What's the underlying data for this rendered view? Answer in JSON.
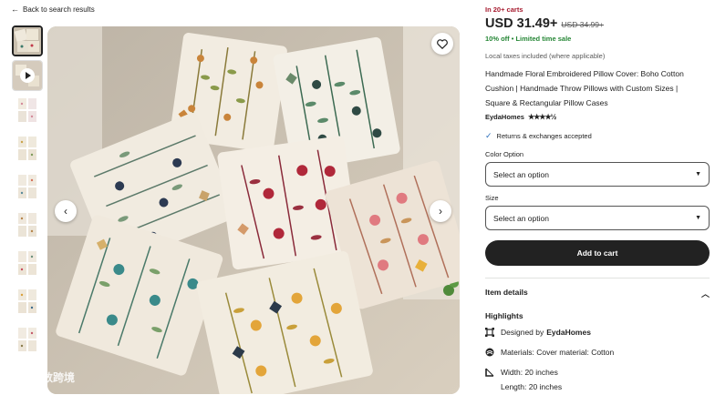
{
  "nav": {
    "back_label": "Back to search results"
  },
  "listing": {
    "carts_badge": "In 20+ carts",
    "price": "USD 31.49+",
    "original_price": "USD 34.99+",
    "discount_text": "10% off • Limited time sale",
    "tax_note": "Local taxes included (where applicable)",
    "title": "Handmade Floral Embroidered Pillow Cover: Boho Cotton Cushion | Handmade Throw Pillows with Custom Sizes | Square & Rectangular Pillow Cases",
    "shop_name": "EydaHomes",
    "rating_stars": "★★★★½",
    "returns_text": "Returns & exchanges accepted"
  },
  "options": {
    "color_label": "Color Option",
    "color_value": "Select an option",
    "size_label": "Size",
    "size_value": "Select an option"
  },
  "cart": {
    "add_label": "Add to cart"
  },
  "details": {
    "section_label": "Item details",
    "highlights_label": "Highlights",
    "designed_by_prefix": "Designed by",
    "designed_by_shop": "EydaHomes",
    "materials": "Materials: Cover material: Cotton",
    "width": "Width: 20 inches",
    "length": "Length: 20 inches"
  },
  "watermark": {
    "text": "大数跨境"
  },
  "icons": {
    "back": "arrow-left-icon",
    "favorite": "heart-icon",
    "prev": "chevron-left-icon",
    "next": "chevron-right-icon",
    "play": "play-icon",
    "check": "check-icon",
    "caret": "caret-down-icon",
    "collapse": "chevron-up-icon",
    "designed": "design-frame-icon",
    "materials": "materials-icon",
    "dimensions": "ruler-icon"
  },
  "colors": {
    "carts_badge": "#a61a2e",
    "discount": "#258635",
    "cart_button": "#222222",
    "check": "#2a6ebb"
  }
}
